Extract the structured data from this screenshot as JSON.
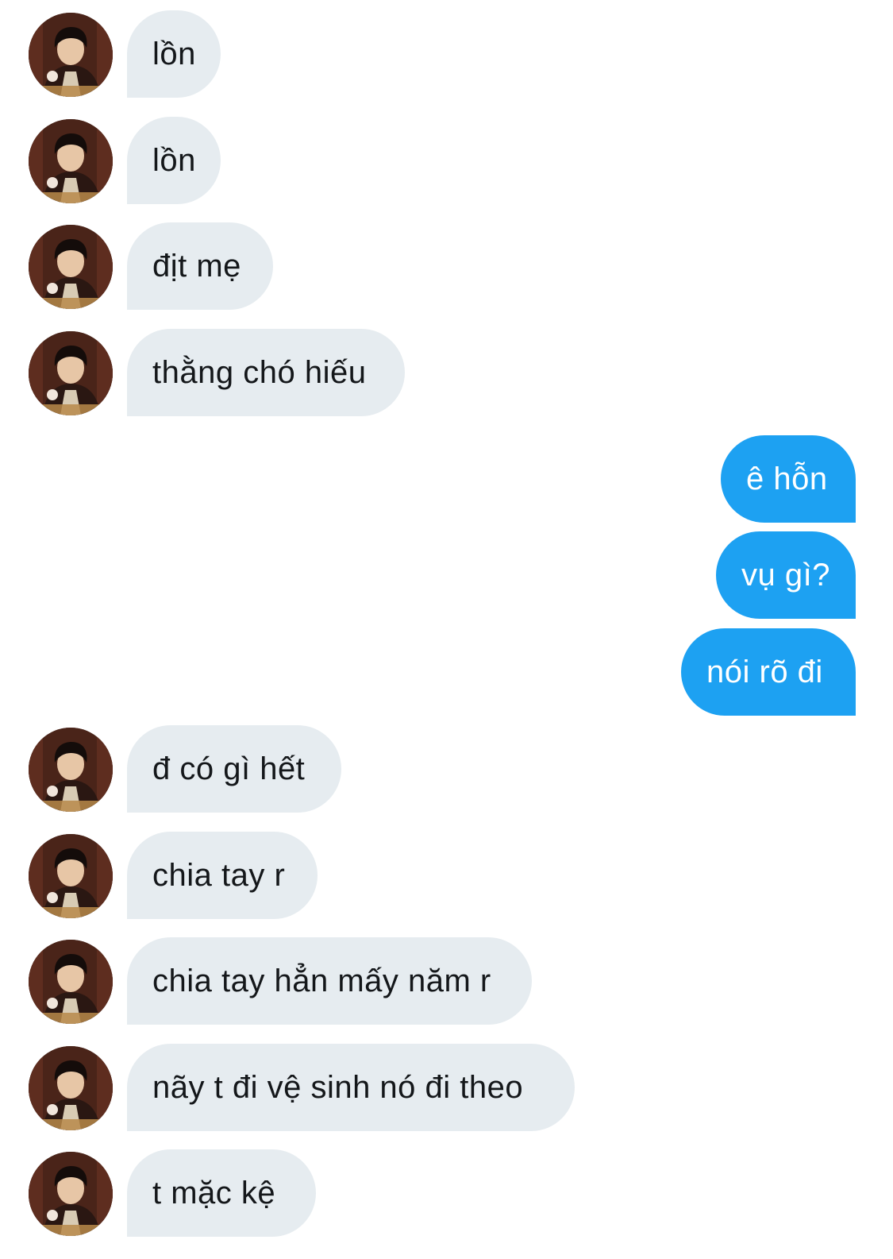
{
  "conversation": {
    "messages": [
      {
        "direction": "incoming",
        "text": "lồn"
      },
      {
        "direction": "incoming",
        "text": "lồn"
      },
      {
        "direction": "incoming",
        "text": "địt mẹ"
      },
      {
        "direction": "incoming",
        "text": "thằng chó hiếu"
      },
      {
        "direction": "outgoing",
        "text": "ê hỗn"
      },
      {
        "direction": "outgoing",
        "text": "vụ gì?"
      },
      {
        "direction": "outgoing",
        "text": "nói rõ đi"
      },
      {
        "direction": "incoming",
        "text": "đ có gì hết"
      },
      {
        "direction": "incoming",
        "text": "chia tay r"
      },
      {
        "direction": "incoming",
        "text": "chia tay hẳn mấy năm r"
      },
      {
        "direction": "incoming",
        "text": "nãy t đi vệ sinh nó đi theo"
      },
      {
        "direction": "incoming",
        "text": "t mặc kệ"
      }
    ]
  },
  "colors": {
    "incoming_bubble": "#e6ecf0",
    "incoming_text": "#14171a",
    "outgoing_bubble": "#1da1f2",
    "outgoing_text": "#ffffff"
  },
  "icons": {
    "sender_avatar": "avatar-photo"
  }
}
